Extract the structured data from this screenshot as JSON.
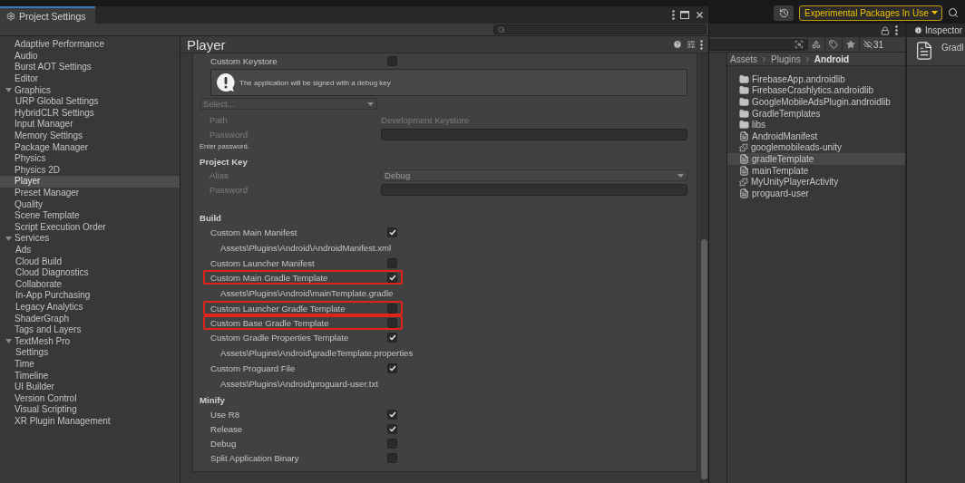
{
  "window": {
    "title": "Project Settings"
  },
  "sidebar": {
    "items": [
      {
        "label": "Adaptive Performance",
        "selected": false
      },
      {
        "label": "Audio",
        "selected": false
      },
      {
        "label": "Burst AOT Settings",
        "selected": false
      },
      {
        "label": "Editor",
        "selected": false
      },
      {
        "label": "Graphics",
        "selected": false,
        "expanded": true,
        "children": [
          {
            "label": "URP Global Settings",
            "selected": false
          }
        ]
      },
      {
        "label": "HybridCLR Settings",
        "selected": false
      },
      {
        "label": "Input Manager",
        "selected": false
      },
      {
        "label": "Memory Settings",
        "selected": false
      },
      {
        "label": "Package Manager",
        "selected": false
      },
      {
        "label": "Physics",
        "selected": false
      },
      {
        "label": "Physics 2D",
        "selected": false
      },
      {
        "label": "Player",
        "selected": true
      },
      {
        "label": "Preset Manager",
        "selected": false
      },
      {
        "label": "Quality",
        "selected": false
      },
      {
        "label": "Scene Template",
        "selected": false
      },
      {
        "label": "Script Execution Order",
        "selected": false
      },
      {
        "label": "Services",
        "selected": false,
        "expanded": true,
        "children": [
          {
            "label": "Ads",
            "selected": false
          },
          {
            "label": "Cloud Build",
            "selected": false
          },
          {
            "label": "Cloud Diagnostics",
            "selected": false
          },
          {
            "label": "Collaborate",
            "selected": false
          },
          {
            "label": "In-App Purchasing",
            "selected": false
          },
          {
            "label": "Legacy Analytics",
            "selected": false
          }
        ]
      },
      {
        "label": "ShaderGraph",
        "selected": false
      },
      {
        "label": "Tags and Layers",
        "selected": false
      },
      {
        "label": "TextMesh Pro",
        "selected": false,
        "expanded": true,
        "children": [
          {
            "label": "Settings",
            "selected": false
          }
        ]
      },
      {
        "label": "Time",
        "selected": false
      },
      {
        "label": "Timeline",
        "selected": false
      },
      {
        "label": "UI Builder",
        "selected": false
      },
      {
        "label": "Version Control",
        "selected": false
      },
      {
        "label": "Visual Scripting",
        "selected": false
      },
      {
        "label": "XR Plugin Management",
        "selected": false
      }
    ]
  },
  "panel": {
    "title": "Player"
  },
  "settings": [
    {
      "kind": "checkbox",
      "label": "Custom Keystore",
      "checked": false,
      "highlighted": false
    },
    {
      "kind": "help",
      "text": "The application will be signed with a debug key"
    },
    {
      "kind": "select",
      "value": "Select...",
      "disabled": true
    },
    {
      "kind": "value",
      "label": "Path",
      "value": "Development Keystore",
      "disabled": true
    },
    {
      "kind": "password",
      "label": "Password",
      "disabled": true
    },
    {
      "kind": "note",
      "text": "Enter password."
    },
    {
      "kind": "heading",
      "text": "Project Key"
    },
    {
      "kind": "dropdown",
      "label": "Alias",
      "value": "Debug",
      "disabled": true
    },
    {
      "kind": "password",
      "label": "Password",
      "disabled": true
    },
    {
      "kind": "heading",
      "text": "Build"
    },
    {
      "kind": "checkbox",
      "label": "Custom Main Manifest",
      "checked": true,
      "highlighted": false
    },
    {
      "kind": "path",
      "text": "Assets\\Plugins\\Android\\AndroidManifest.xml"
    },
    {
      "kind": "checkbox",
      "label": "Custom Launcher Manifest",
      "checked": false,
      "highlighted": false
    },
    {
      "kind": "checkbox",
      "label": "Custom Main Gradle Template",
      "checked": true,
      "highlighted": true
    },
    {
      "kind": "path",
      "text": "Assets\\Plugins\\Android\\mainTemplate.gradle"
    },
    {
      "kind": "checkbox",
      "label": "Custom Launcher Gradle Template",
      "checked": false,
      "highlighted": true
    },
    {
      "kind": "checkbox",
      "label": "Custom Base Gradle Template",
      "checked": false,
      "highlighted": true
    },
    {
      "kind": "checkbox",
      "label": "Custom Gradle Properties Template",
      "checked": true,
      "highlighted": false
    },
    {
      "kind": "path",
      "text": "Assets\\Plugins\\Android\\gradleTemplate.properties"
    },
    {
      "kind": "checkbox",
      "label": "Custom Proguard File",
      "checked": true,
      "highlighted": false
    },
    {
      "kind": "path",
      "text": "Assets\\Plugins\\Android\\proguard-user.txt"
    },
    {
      "kind": "heading",
      "text": "Minify"
    },
    {
      "kind": "checkbox",
      "label": "Use R8",
      "checked": true,
      "highlighted": false
    },
    {
      "kind": "checkbox",
      "label": "Release",
      "checked": true,
      "highlighted": false
    },
    {
      "kind": "checkbox",
      "label": "Debug",
      "checked": false,
      "highlighted": false
    },
    {
      "kind": "checkbox",
      "label": "Split Application Binary",
      "checked": false,
      "highlighted": false
    }
  ],
  "toolbar": {
    "packages_button": "Experimental Packages In Use"
  },
  "browser": {
    "hidden_count": "31",
    "breadcrumb": [
      {
        "label": "Assets",
        "current": false
      },
      {
        "label": "Plugins",
        "current": false
      },
      {
        "label": "Android",
        "current": true
      }
    ],
    "files": [
      {
        "name": "FirebaseApp.androidlib",
        "kind": "folder",
        "selected": false
      },
      {
        "name": "FirebaseCrashlytics.androidlib",
        "kind": "folder",
        "selected": false
      },
      {
        "name": "GoogleMobileAdsPlugin.androidlib",
        "kind": "folder",
        "selected": false
      },
      {
        "name": "GradleTemplates",
        "kind": "folder",
        "selected": false
      },
      {
        "name": "libs",
        "kind": "folder",
        "selected": false
      },
      {
        "name": "AndroidManifest",
        "kind": "document",
        "selected": false
      },
      {
        "name": "googlemobileads-unity",
        "kind": "plugin",
        "selected": false
      },
      {
        "name": "gradleTemplate",
        "kind": "document",
        "selected": true
      },
      {
        "name": "mainTemplate",
        "kind": "document",
        "selected": false
      },
      {
        "name": "MyUnityPlayerActivity",
        "kind": "plugin",
        "selected": false
      },
      {
        "name": "proguard-user",
        "kind": "document",
        "selected": false
      }
    ]
  },
  "inspector": {
    "title": "Inspector",
    "asset_name": "Gradl"
  }
}
